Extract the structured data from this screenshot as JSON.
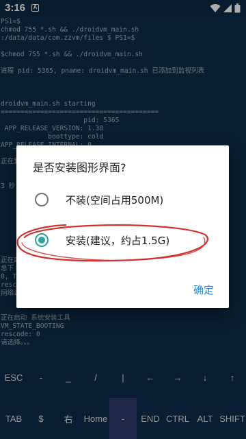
{
  "status_bar": {
    "time": "3:16",
    "notification_letter": "A"
  },
  "terminal": {
    "lines": [
      "PS1=$",
      "chmod 755 *.sh && ./droidvm_main.sh",
      ":/data/data/com.zzvm/files $ PS1=$",
      "",
      "$chmod 755 *.sh && ./droidvm_main.sh",
      "",
      "进程 pid: 5365, pname: droidvm_main.sh 已添加到监视列表",
      "",
      "",
      "",
      "droidvm_main.sh starting",
      "========================================",
      "                     pid: 5365",
      " APP_RELEASE_VERSION: 1.38",
      "            boottype: cold",
      "APP_RELEASE_INTERNAL: 0",
      "",
      "正在复",
      "",
      "",
      "3 秒",
      "",
      "",
      "",
      "",
      "",
      "",
      "",
      "",
      "正在启",
      "总下",
      "0, T",
      "resco",
      "网络设",
      "",
      "",
      "正在启动 系统安装工具",
      "VM_STATE_BOOTING",
      "rescode: 0",
      "请选择。。。"
    ]
  },
  "extra_keys": {
    "row1": [
      "ESC",
      "-",
      "_",
      "/",
      "|",
      "←",
      "→",
      "↓",
      "↑"
    ],
    "row2": [
      "TAB",
      "$",
      "右",
      "Home",
      "-",
      "END",
      "CTRL",
      "ALT",
      "SHIFT"
    ],
    "highlighted_key": "-"
  },
  "dialog": {
    "title": "是否安装图形界面?",
    "options": [
      {
        "label": "不装(空间占用500M)",
        "checked": false
      },
      {
        "label": "安装(建议，约占1.5G)",
        "checked": true
      }
    ],
    "confirm_label": "确定"
  },
  "colors": {
    "terminal_bg": "#0d2d4a",
    "accent": "#26a69a",
    "button_text": "#1e88e5",
    "annotation": "#d32f2f"
  }
}
